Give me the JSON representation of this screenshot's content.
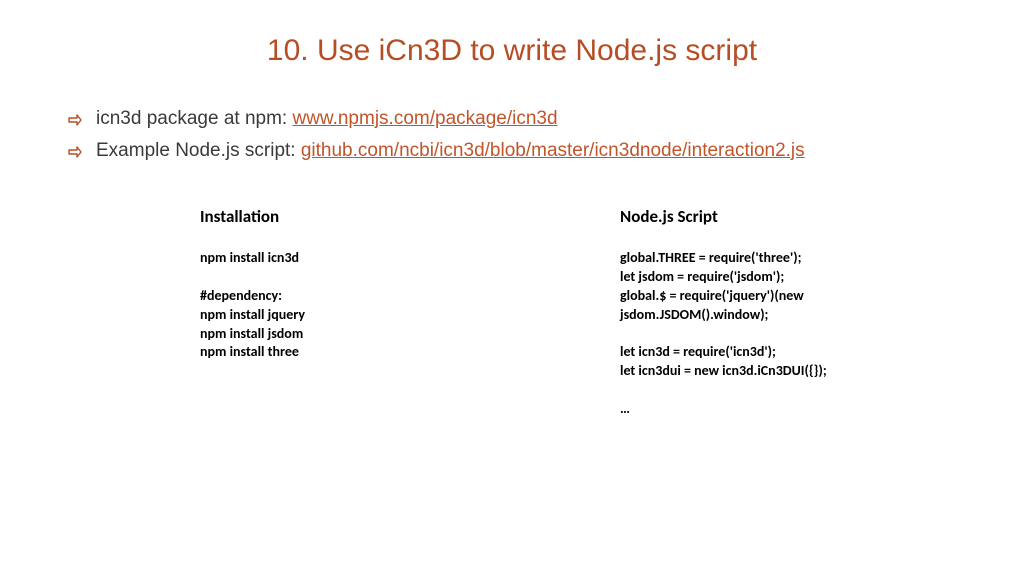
{
  "title": "10. Use iCn3D to write Node.js script",
  "bullets": [
    {
      "label": "icn3d package at npm: ",
      "link": "www.npmjs.com/package/icn3d"
    },
    {
      "label": "Example Node.js script: ",
      "link": "github.com/ncbi/icn3d/blob/master/icn3dnode/interaction2.js"
    }
  ],
  "columns": {
    "left": {
      "heading": "Installation",
      "body": "npm install icn3d\n\n#dependency:\nnpm install jquery\nnpm install jsdom\nnpm install three"
    },
    "right": {
      "heading": "Node.js Script",
      "body": "global.THREE = require('three');\nlet jsdom = require('jsdom');\nglobal.$ = require('jquery')(new jsdom.JSDOM().window);\n\nlet icn3d = require('icn3d');\nlet icn3dui = new icn3d.iCn3DUI({});\n\n…"
    }
  }
}
